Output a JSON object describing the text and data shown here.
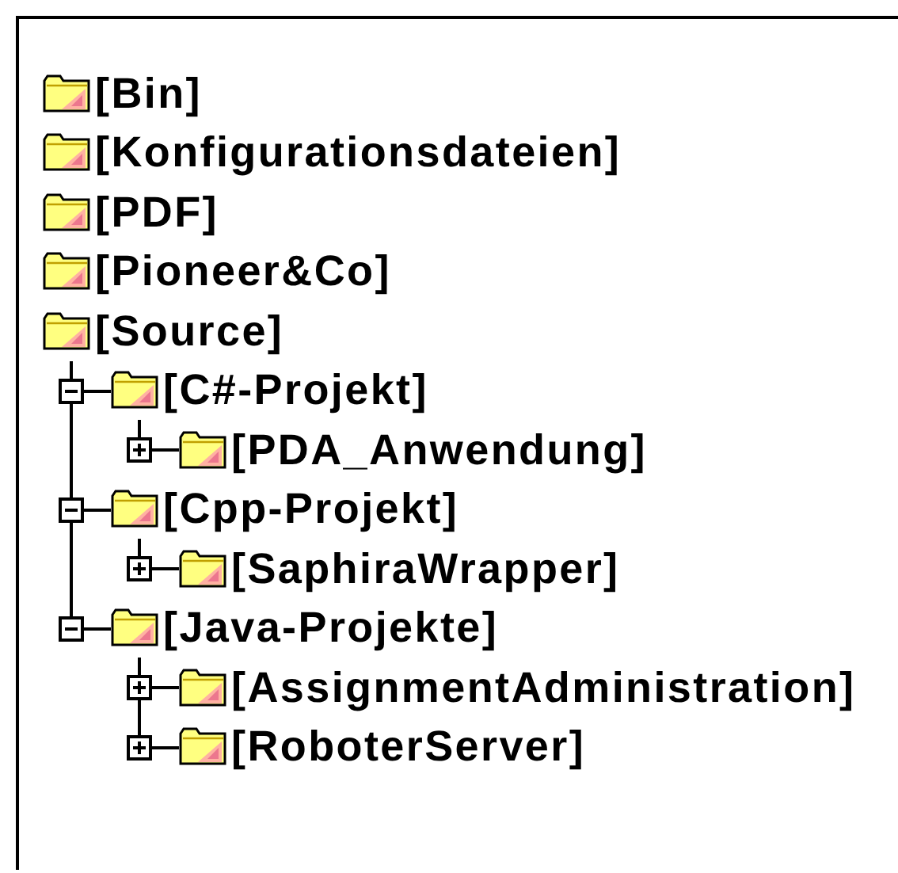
{
  "tree": [
    {
      "label": "[Bin]"
    },
    {
      "label": "[Konfigurationsdateien]"
    },
    {
      "label": "[PDF]"
    },
    {
      "label": "[Pioneer&Co]"
    },
    {
      "label": "[Source]",
      "children": [
        {
          "label": "[C#-Projekt]",
          "expanded": true,
          "children": [
            {
              "label": "[PDA_Anwendung]",
              "expanded": false
            }
          ]
        },
        {
          "label": "[Cpp-Projekt]",
          "expanded": true,
          "children": [
            {
              "label": "[SaphiraWrapper]",
              "expanded": false
            }
          ]
        },
        {
          "label": "[Java-Projekte]",
          "expanded": true,
          "children": [
            {
              "label": "[AssignmentAdministration]",
              "expanded": false
            },
            {
              "label": "[RoboterServer]",
              "expanded": false
            }
          ]
        }
      ]
    }
  ]
}
